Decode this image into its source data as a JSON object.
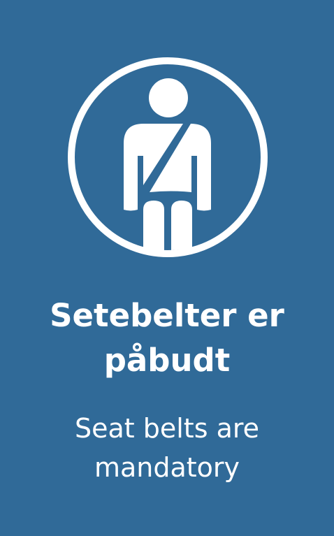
{
  "sign": {
    "icon": "seatbelt-person-icon",
    "background_color": "#306a98",
    "title_lines": [
      "Setebelter er",
      "påbudt"
    ],
    "subtitle_lines": [
      "Seat belts are",
      "mandatory"
    ]
  }
}
